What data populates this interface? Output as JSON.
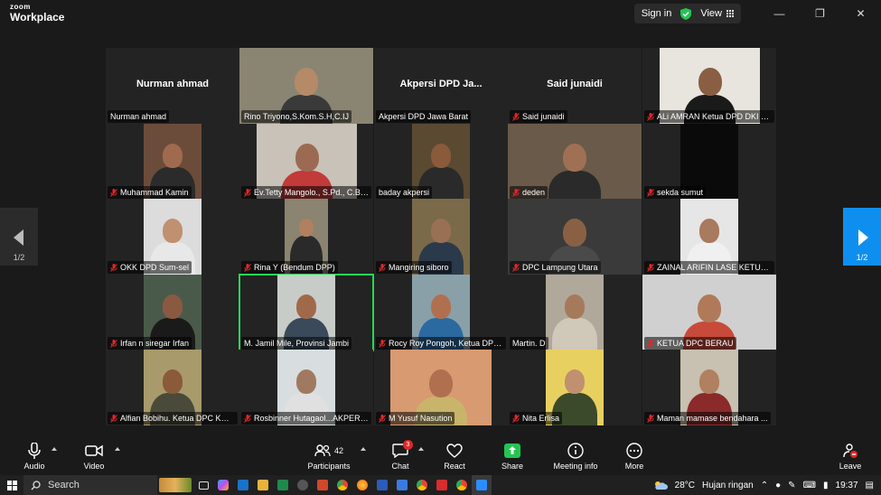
{
  "app": {
    "brand_small": "zoom",
    "brand_large": "Workplace"
  },
  "titlebar": {
    "signin_label": "Sign in",
    "view_label": "View"
  },
  "page": {
    "left_indicator": "1/2",
    "right_indicator": "1/2"
  },
  "tiles": [
    {
      "name": "Nurman ahmad",
      "label": "Nurman ahmad",
      "muted": false,
      "video": false
    },
    {
      "name": "",
      "label": "Rino Triyono,S.Kom.S.H,C.IJ",
      "muted": false,
      "video": true
    },
    {
      "name": "Akpersi DPD Ja...",
      "label": "Akpersi DPD Jawa Barat",
      "muted": false,
      "video": false
    },
    {
      "name": "Said junaidi",
      "label": "Said junaidi",
      "muted": true,
      "video": false
    },
    {
      "name": "",
      "label": "ALi AMRAN Ketua DPD DKI Ja...",
      "muted": true,
      "video": true
    },
    {
      "name": "",
      "label": "Muhammad Kamin",
      "muted": true,
      "video": true
    },
    {
      "name": "",
      "label": "Ev.Tetty Mangolo., S.Pd., C.BJ,...",
      "muted": true,
      "video": true
    },
    {
      "name": "",
      "label": "baday akpersi",
      "muted": false,
      "video": true
    },
    {
      "name": "",
      "label": "deden",
      "muted": true,
      "video": true
    },
    {
      "name": "",
      "label": "sekda sumut",
      "muted": true,
      "video": true
    },
    {
      "name": "",
      "label": "OKK DPD Sum-sel",
      "muted": true,
      "video": true
    },
    {
      "name": "",
      "label": "Rina Y (Bendum DPP)",
      "muted": true,
      "video": true
    },
    {
      "name": "",
      "label": "Mangiring siboro",
      "muted": true,
      "video": true
    },
    {
      "name": "",
      "label": "DPC Lampung Utara",
      "muted": true,
      "video": true
    },
    {
      "name": "",
      "label": "ZAINAL ARIFIN LASE KETUA D...",
      "muted": true,
      "video": true
    },
    {
      "name": "",
      "label": "Irfan n siregar Irfan",
      "muted": true,
      "video": true
    },
    {
      "name": "",
      "label": "M. Jamil Mile, Provinsi Jambi",
      "muted": false,
      "video": true
    },
    {
      "name": "",
      "label": "Rocy Roy Pongoh, Ketua DPC...",
      "muted": true,
      "video": true
    },
    {
      "name": "",
      "label": "Martin. D",
      "muted": false,
      "video": true
    },
    {
      "name": "",
      "label": "KETUA DPC BERAU",
      "muted": true,
      "video": true
    },
    {
      "name": "",
      "label": "Alfian Bobihu. Ketua DPC KOT...",
      "muted": true,
      "video": true
    },
    {
      "name": "",
      "label": "Rosbinner Hutagaol...AKPERSI...",
      "muted": true,
      "video": true
    },
    {
      "name": "",
      "label": "M Yusuf Nasution",
      "muted": true,
      "video": true
    },
    {
      "name": "",
      "label": "Nita Erlisa",
      "muted": true,
      "video": true
    },
    {
      "name": "",
      "label": "Maman mamase bendahara ...",
      "muted": true,
      "video": true
    }
  ],
  "toolbar": {
    "audio": "Audio",
    "video": "Video",
    "participants": "Participants",
    "participants_count": "42",
    "chat": "Chat",
    "chat_badge": "3",
    "react": "React",
    "share": "Share",
    "meeting_info": "Meeting info",
    "more": "More",
    "leave": "Leave"
  },
  "taskbar": {
    "search": "Search",
    "temperature": "28°C",
    "weather": "Hujan ringan",
    "time": "19:37"
  },
  "colors": {
    "active_speaker": "#23d959",
    "nav_active": "#0e8ff0",
    "muted_icon": "#e02828"
  }
}
